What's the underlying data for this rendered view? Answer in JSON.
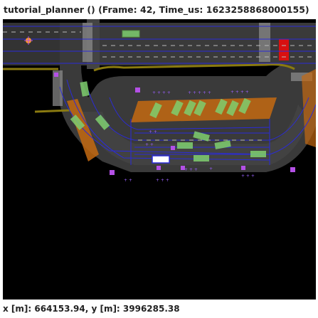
{
  "window": {
    "title": "tutorial_planner () (Frame: 42, Time_us: 1623258868000155)"
  },
  "status": {
    "coordinates": "x [m]: 664153.94, y [m]: 3996285.38"
  },
  "colors": {
    "background": "#000000",
    "road_surface": "#3a3a3a",
    "lane_boundary": "#2b2bd8",
    "crosswalk": "#9a9a9a",
    "vehicle": "#7fcf6f",
    "ego_vehicle": "#ffffff",
    "pedestrian": "#b450e6",
    "stop_line_red": "#d81010",
    "lane_zone_orange": "#c46a12",
    "curb": "#8a7a10"
  },
  "icons": [
    "pedestrian-icon",
    "vehicle-icon",
    "ego-vehicle-icon",
    "traffic-light-icon"
  ]
}
